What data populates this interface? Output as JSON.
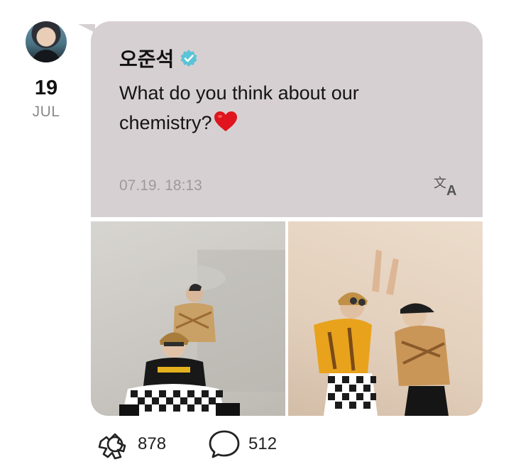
{
  "post": {
    "date": {
      "day": "19",
      "month": "JUL"
    },
    "author": {
      "name": "오준석",
      "verified": true
    },
    "message": "What do you think about our chemistry?",
    "emoji": "heart",
    "timestamp": "07.19. 18:13",
    "accent_color": "#5bc4d6",
    "bubble_color": "#d7d0d2"
  },
  "photos": [
    {
      "name": "photo-left"
    },
    {
      "name": "photo-right"
    }
  ],
  "actions": {
    "like_count": "878",
    "comment_count": "512"
  }
}
